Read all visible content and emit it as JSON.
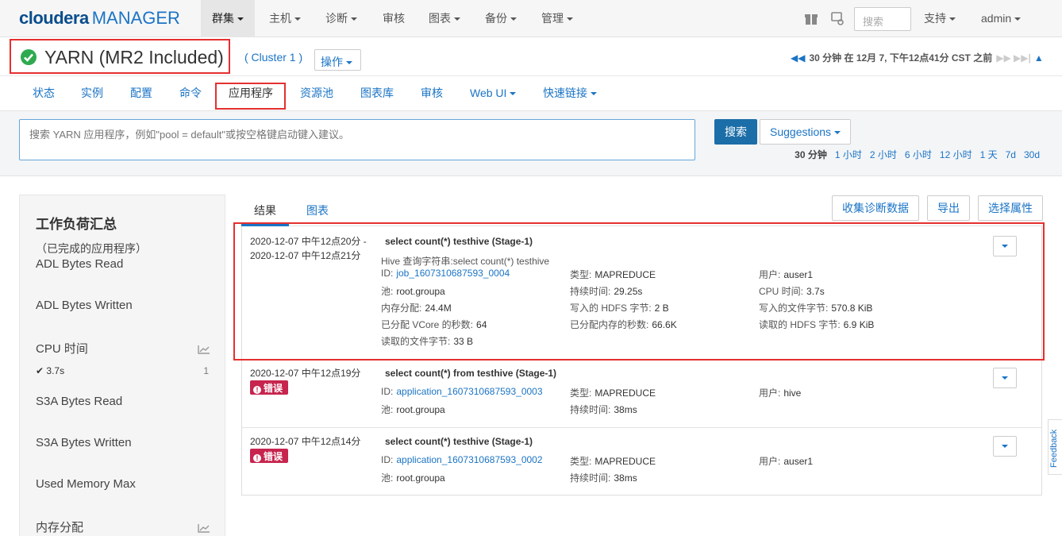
{
  "nav": {
    "logo_brand": "cloudera",
    "logo_product": "MANAGER",
    "items": [
      "群集",
      "主机",
      "诊断",
      "审核",
      "图表",
      "备份",
      "管理"
    ],
    "search_placeholder": "搜索",
    "support": "支持",
    "user": "admin"
  },
  "service": {
    "name": "YARN (MR2 Included)",
    "cluster": "( Cluster 1 )",
    "ops": "操作",
    "time_text": "30 分钟 在 12月 7, 下午12点41分 CST 之前",
    "status_color": "#2faa4f"
  },
  "tabs": [
    "状态",
    "实例",
    "配置",
    "命令",
    "应用程序",
    "资源池",
    "图表库",
    "审核",
    "Web UI",
    "快速链接"
  ],
  "search": {
    "placeholder": "搜索 YARN 应用程序，例如\"pool = default\"或按空格键启动键入建议。",
    "button": "搜索",
    "suggestions": "Suggestions",
    "ranges": [
      "30 分钟",
      "1 小时",
      "2 小时",
      "6 小时",
      "12 小时",
      "1 天",
      "7d",
      "30d"
    ]
  },
  "workload": {
    "title": "工作负荷汇总",
    "subtitle": "（已完成的应用程序）",
    "items": [
      "ADL Bytes Read",
      "ADL Bytes Written",
      "CPU 时间",
      "S3A Bytes Read",
      "S3A Bytes Written",
      "Used Memory Max",
      "内存分配"
    ],
    "cpu_value": "3.7s",
    "cpu_count": "1"
  },
  "results_tabs": [
    "结果",
    "图表"
  ],
  "tools": [
    "收集诊断数据",
    "导出",
    "选择属性"
  ],
  "error_label": "错误",
  "rows": [
    {
      "time1": "2020-12-07 中午12点20分 -",
      "time2": "2020-12-07 中午12点21分",
      "title": "select count(*) testhive (Stage-1)",
      "hive_label": "Hive 查询字符串:",
      "hive_value": "select count(*) testhive",
      "id_label": "ID:",
      "id_value": "job_1607310687593_0004",
      "type_label": "类型:",
      "type_value": "MAPREDUCE",
      "user_label": "用户:",
      "user_value": "auser1",
      "pool_label": "池:",
      "pool_value": "root.groupa",
      "dur_label": "持续时间:",
      "dur_value": "29.25s",
      "cpu_label": "CPU 时间:",
      "cpu_value": "3.7s",
      "mem_label": "内存分配:",
      "mem_value": "24.4M",
      "hdfsw_label": "写入的 HDFS 字节:",
      "hdfsw_value": "2 B",
      "filew_label": "写入的文件字节:",
      "filew_value": "570.8 KiB",
      "vcore_label": "已分配 VCore 的秒数:",
      "vcore_value": "64",
      "memsec_label": "已分配内存的秒数:",
      "memsec_value": "66.6K",
      "hdfsr_label": "读取的 HDFS 字节:",
      "hdfsr_value": "6.9 KiB",
      "filer_label": "读取的文件字节:",
      "filer_value": "33 B"
    },
    {
      "time1": "2020-12-07 中午12点19分",
      "title": "select count(*) from testhive (Stage-1)",
      "id_label": "ID:",
      "id_value": "application_1607310687593_0003",
      "type_label": "类型:",
      "type_value": "MAPREDUCE",
      "user_label": "用户:",
      "user_value": "hive",
      "pool_label": "池:",
      "pool_value": "root.groupa",
      "dur_label": "持续时间:",
      "dur_value": "38ms"
    },
    {
      "time1": "2020-12-07 中午12点14分",
      "title": "select count(*) testhive (Stage-1)",
      "id_label": "ID:",
      "id_value": "application_1607310687593_0002",
      "type_label": "类型:",
      "type_value": "MAPREDUCE",
      "user_label": "用户:",
      "user_value": "auser1",
      "pool_label": "池:",
      "pool_value": "root.groupa",
      "dur_label": "持续时间:",
      "dur_value": "38ms"
    }
  ],
  "feedback": "Feedback"
}
